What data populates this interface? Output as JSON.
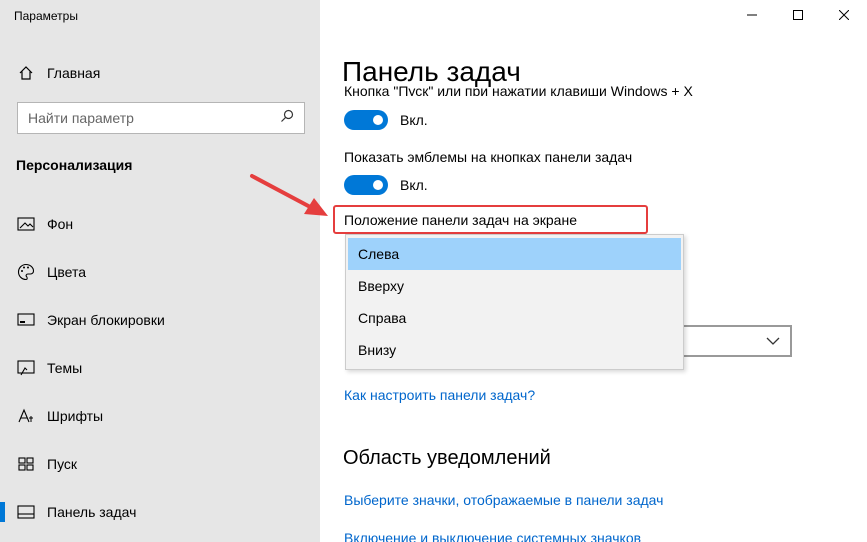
{
  "app": {
    "title": "Параметры"
  },
  "window_controls": {
    "minimize_icon": "minimize-icon",
    "maximize_icon": "maximize-icon",
    "close_icon": "close-icon"
  },
  "sidebar": {
    "home_label": "Главная",
    "search_placeholder": "Найти параметр",
    "section": "Персонализация",
    "items": [
      {
        "label": "Фон",
        "icon": "picture-icon"
      },
      {
        "label": "Цвета",
        "icon": "palette-icon"
      },
      {
        "label": "Экран блокировки",
        "icon": "lock-screen-icon"
      },
      {
        "label": "Темы",
        "icon": "themes-icon"
      },
      {
        "label": "Шрифты",
        "icon": "fonts-icon"
      },
      {
        "label": "Пуск",
        "icon": "start-icon"
      },
      {
        "label": "Панель задач",
        "icon": "taskbar-icon",
        "active": true
      }
    ]
  },
  "main": {
    "title": "Панель задач",
    "clipped_text": "Кнопка \"Пуск\" или при нажатии клавиши Windows + X",
    "toggle1_state": "Вкл.",
    "badges_label": "Показать эмблемы на кнопках панели задач",
    "toggle2_state": "Вкл.",
    "position_label": "Положение панели задач на экране",
    "position_options": [
      "Слева",
      "Вверху",
      "Справа",
      "Внизу"
    ],
    "selected_option": "Слева",
    "help_link": "Как настроить панели задач?",
    "notifications_heading": "Область уведомлений",
    "notif_link1": "Выберите значки, отображаемые в панели задач",
    "notif_link2": "Включение и выключение системных значков"
  },
  "colors": {
    "accent": "#0078d7",
    "highlight_border": "#e53e3e",
    "selected_option_bg": "#9ed2fb",
    "link": "#0066cc"
  }
}
